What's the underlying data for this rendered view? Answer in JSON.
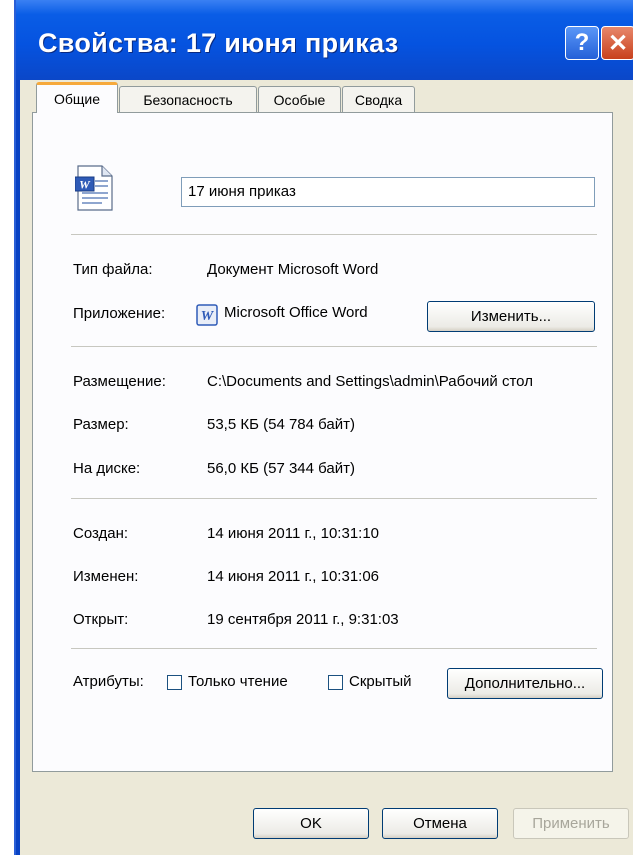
{
  "window": {
    "title": "Свойства: 17 июня приказ",
    "help_glyph": "?",
    "close_glyph": "✕"
  },
  "tabs": [
    {
      "label": "Общие",
      "active": true
    },
    {
      "label": "Безопасность",
      "active": false
    },
    {
      "label": "Особые",
      "active": false
    },
    {
      "label": "Сводка",
      "active": false
    }
  ],
  "general": {
    "file_icon": "word-document-icon",
    "file_name": "17 июня приказ",
    "file_type_label": "Тип файла:",
    "file_type_value": "Документ Microsoft Word",
    "app_label": "Приложение:",
    "app_icon": "word-app-icon",
    "app_value": "Microsoft Office Word",
    "change_button": "Изменить...",
    "location_label": "Размещение:",
    "location_value": "C:\\Documents and Settings\\admin\\Рабочий стол",
    "size_label": "Размер:",
    "size_value": "53,5 КБ (54 784 байт)",
    "disk_label": "На диске:",
    "disk_value": "56,0 КБ (57 344 байт)",
    "created_label": "Создан:",
    "created_value": "14 июня 2011 г., 10:31:10",
    "modified_label": "Изменен:",
    "modified_value": "14 июня 2011 г., 10:31:06",
    "accessed_label": "Открыт:",
    "accessed_value": "19 сентября 2011 г., 9:31:03",
    "attributes_label": "Атрибуты:",
    "readonly_label": "Только чтение",
    "readonly_checked": false,
    "hidden_label": "Скрытый",
    "hidden_checked": false,
    "advanced_button": "Дополнительно..."
  },
  "footer": {
    "ok": "OK",
    "cancel": "Отмена",
    "apply": "Применить"
  }
}
